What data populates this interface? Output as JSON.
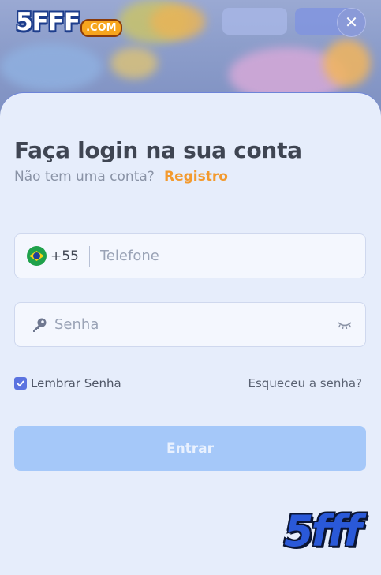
{
  "header": {
    "brand_main": "5FFF",
    "brand_suffix": ".COM",
    "close_icon": "close-icon",
    "close_glyph": "✕"
  },
  "login": {
    "title": "Faça login na sua conta",
    "subtitle": "Não tem uma conta?",
    "register_link": "Registro",
    "phone": {
      "flag_icon": "brazil-flag-icon",
      "country_code": "+55",
      "placeholder": "Telefone",
      "value": ""
    },
    "password": {
      "lock_icon": "key-icon",
      "placeholder": "Senha",
      "value": "",
      "visibility_icon": "eye-closed-icon"
    },
    "remember": {
      "label": "Lembrar Senha",
      "checked": true
    },
    "forgot_link": "Esqueceu a senha?",
    "submit_label": "Entrar"
  },
  "watermark": "5fff",
  "colors": {
    "accent": "#f39a2e",
    "primary": "#5b73e0",
    "button_disabled": "#a5c8f9",
    "sheet_bg": "#e6edfb"
  }
}
